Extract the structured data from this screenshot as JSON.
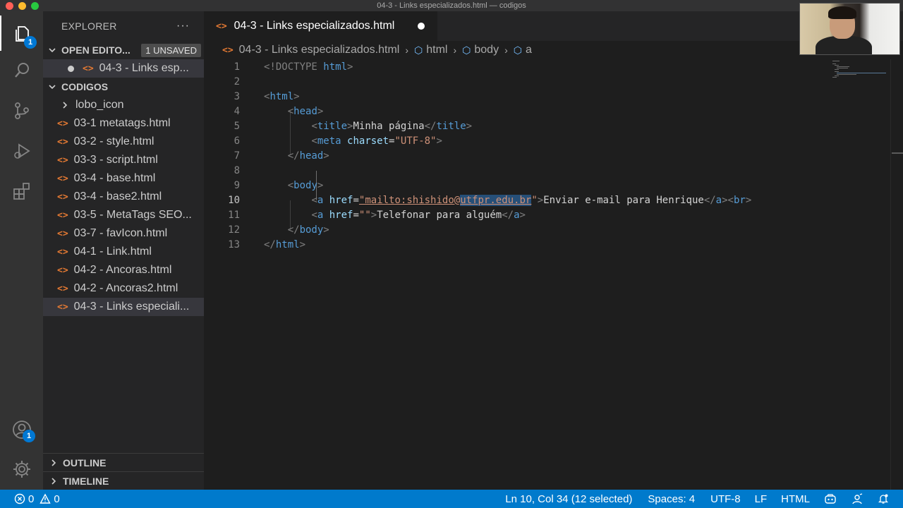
{
  "window": {
    "title": "04-3 - Links especializados.html — codigos"
  },
  "activity": {
    "explorer_badge": "1",
    "account_badge": "1"
  },
  "sidebar": {
    "header": "EXPLORER",
    "open_editors": {
      "label": "OPEN EDITO...",
      "badge": "1 UNSAVED",
      "item": "04-3 - Links esp..."
    },
    "folder": {
      "label": "CODIGOS",
      "subfolder": "lobo_icon",
      "files": [
        "03-1 metatags.html",
        "03-2 - style.html",
        "03-3 - script.html",
        "03-4 - base.html",
        "03-4 - base2.html",
        "03-5 - MetaTags SEO...",
        "03-7 - favIcon.html",
        "04-1 - Link.html",
        "04-2 - Ancoras.html",
        "04-2 - Ancoras2.html",
        "04-3 - Links especiali..."
      ]
    },
    "outline": "OUTLINE",
    "timeline": "TIMELINE"
  },
  "tab": {
    "label": "04-3 - Links especializados.html"
  },
  "breadcrumb": {
    "file": "04-3 - Links especializados.html",
    "html": "html",
    "body": "body",
    "a": "a"
  },
  "editor": {
    "line_numbers": [
      "1",
      "2",
      "3",
      "4",
      "5",
      "6",
      "7",
      "8",
      "9",
      "10",
      "11",
      "12",
      "13"
    ],
    "doctype": "<!DOCTYPE",
    "doctype_html": "html",
    "title_text": "Minha página",
    "meta_attr": "charset",
    "meta_val": "\"UTF-8\"",
    "href_attr": "href",
    "mailto_a": "\"mailto:shishido@",
    "mailto_sel": "utfpr.edu.br",
    "mailto_end": "\"",
    "link1_text": "Enviar e-mail para Henrique",
    "href2_val": "\"\"",
    "link2_text": "Telefonar para alguém"
  },
  "status": {
    "errors": "0",
    "warnings": "0",
    "position": "Ln 10, Col 34 (12 selected)",
    "spaces": "Spaces: 4",
    "encoding": "UTF-8",
    "eol": "LF",
    "language": "HTML"
  },
  "colors": {
    "statusbar": "#007acc",
    "accent": "#0078d4",
    "html_icon": "#e37933"
  }
}
